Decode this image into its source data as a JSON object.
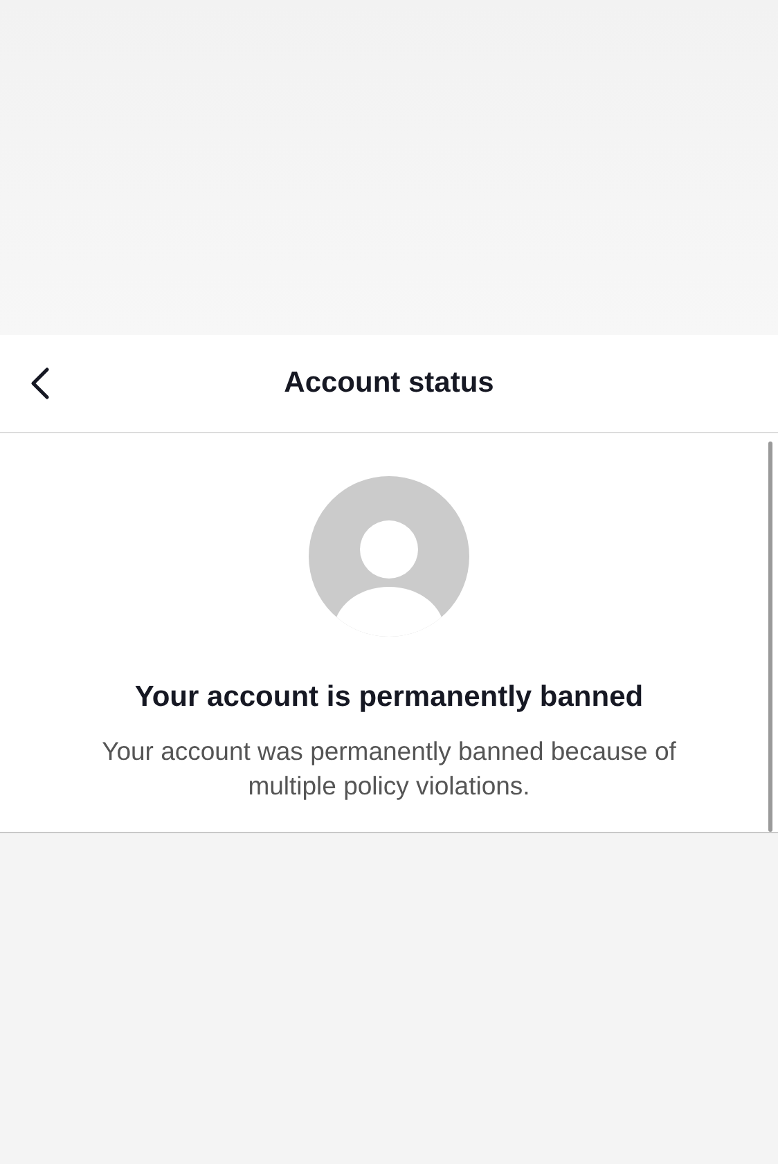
{
  "header": {
    "title": "Account status"
  },
  "status": {
    "heading": "Your account is permanently banned",
    "message": "Your account was permanently banned because of multiple policy violations."
  }
}
